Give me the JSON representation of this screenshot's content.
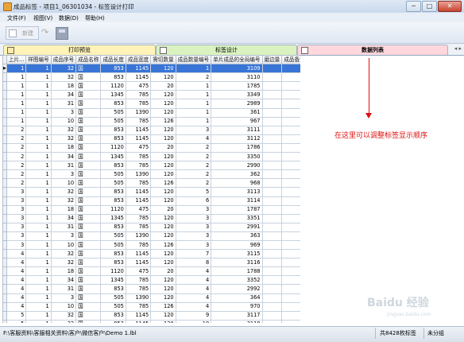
{
  "window": {
    "title": "成品标签 - 项目1_06301034 - 标签设计打印",
    "min": "─",
    "max": "□",
    "close": "✕"
  },
  "menu": [
    "文件(F)",
    "视图(V)",
    "数据(D)",
    "帮助(H)"
  ],
  "toolbar": {
    "new_label": "新建"
  },
  "tabs": [
    "打印预览",
    "标签设计",
    "数据列表"
  ],
  "tab_scroll": "◂ ▸",
  "table": {
    "headers": [
      "上片...",
      "样图编号",
      "成品序号",
      "成品名称",
      "成品长度",
      "成品宽度",
      "需切数量",
      "成品数量编号",
      "单片成品的全局编号",
      "磨边量",
      "成品备注"
    ],
    "rows": [
      [
        "1",
        "1",
        "32",
        "国",
        "853",
        "1145",
        "120",
        "1",
        "3109",
        "",
        ""
      ],
      [
        "1",
        "1",
        "32",
        "国",
        "853",
        "1145",
        "120",
        "2",
        "3110",
        "",
        ""
      ],
      [
        "1",
        "1",
        "18",
        "国",
        "1120",
        "475",
        "20",
        "1",
        "1785",
        "",
        ""
      ],
      [
        "1",
        "1",
        "34",
        "国",
        "1345",
        "785",
        "120",
        "1",
        "3349",
        "",
        ""
      ],
      [
        "1",
        "1",
        "31",
        "国",
        "853",
        "785",
        "120",
        "1",
        "2989",
        "",
        ""
      ],
      [
        "1",
        "1",
        "3",
        "国",
        "505",
        "1390",
        "120",
        "1",
        "361",
        "",
        ""
      ],
      [
        "1",
        "1",
        "10",
        "国",
        "505",
        "785",
        "126",
        "1",
        "967",
        "",
        ""
      ],
      [
        "2",
        "1",
        "32",
        "国",
        "853",
        "1145",
        "120",
        "3",
        "3111",
        "",
        ""
      ],
      [
        "2",
        "1",
        "32",
        "国",
        "853",
        "1145",
        "120",
        "4",
        "3112",
        "",
        ""
      ],
      [
        "2",
        "1",
        "18",
        "国",
        "1120",
        "475",
        "20",
        "2",
        "1786",
        "",
        ""
      ],
      [
        "2",
        "1",
        "34",
        "国",
        "1345",
        "785",
        "120",
        "2",
        "3350",
        "",
        ""
      ],
      [
        "2",
        "1",
        "31",
        "国",
        "853",
        "785",
        "120",
        "2",
        "2990",
        "",
        ""
      ],
      [
        "2",
        "1",
        "3",
        "国",
        "505",
        "1390",
        "120",
        "2",
        "362",
        "",
        ""
      ],
      [
        "2",
        "1",
        "10",
        "国",
        "505",
        "785",
        "126",
        "2",
        "968",
        "",
        ""
      ],
      [
        "3",
        "1",
        "32",
        "国",
        "853",
        "1145",
        "120",
        "5",
        "3113",
        "",
        ""
      ],
      [
        "3",
        "1",
        "32",
        "国",
        "853",
        "1145",
        "120",
        "6",
        "3114",
        "",
        ""
      ],
      [
        "3",
        "1",
        "18",
        "国",
        "1120",
        "475",
        "20",
        "3",
        "1787",
        "",
        ""
      ],
      [
        "3",
        "1",
        "34",
        "国",
        "1345",
        "785",
        "120",
        "3",
        "3351",
        "",
        ""
      ],
      [
        "3",
        "1",
        "31",
        "国",
        "853",
        "785",
        "120",
        "3",
        "2991",
        "",
        ""
      ],
      [
        "3",
        "1",
        "3",
        "国",
        "505",
        "1390",
        "120",
        "3",
        "363",
        "",
        ""
      ],
      [
        "3",
        "1",
        "10",
        "国",
        "505",
        "785",
        "126",
        "3",
        "969",
        "",
        ""
      ],
      [
        "4",
        "1",
        "32",
        "国",
        "853",
        "1145",
        "120",
        "7",
        "3115",
        "",
        ""
      ],
      [
        "4",
        "1",
        "32",
        "国",
        "853",
        "1145",
        "120",
        "8",
        "3116",
        "",
        ""
      ],
      [
        "4",
        "1",
        "18",
        "国",
        "1120",
        "475",
        "20",
        "4",
        "1788",
        "",
        ""
      ],
      [
        "4",
        "1",
        "34",
        "国",
        "1345",
        "785",
        "120",
        "4",
        "3352",
        "",
        ""
      ],
      [
        "4",
        "1",
        "31",
        "国",
        "853",
        "785",
        "120",
        "4",
        "2992",
        "",
        ""
      ],
      [
        "4",
        "1",
        "3",
        "国",
        "505",
        "1390",
        "120",
        "4",
        "364",
        "",
        ""
      ],
      [
        "4",
        "1",
        "10",
        "国",
        "505",
        "785",
        "126",
        "4",
        "970",
        "",
        ""
      ],
      [
        "5",
        "1",
        "32",
        "国",
        "853",
        "1145",
        "120",
        "9",
        "3117",
        "",
        ""
      ],
      [
        "5",
        "1",
        "32",
        "国",
        "853",
        "1145",
        "120",
        "10",
        "3118",
        "",
        ""
      ]
    ],
    "selected_row": 0,
    "row_pointer": "▶"
  },
  "annotation": {
    "text": "在这里可以调整标签显示顺序",
    "color": "#dd1111"
  },
  "watermark": {
    "text": "Baidu 经验",
    "sub": "jingyan.baidu.com"
  },
  "status": {
    "path": "F:\\客服资料\\客服相关资料\\客户\\微信客户\\Demo 1.lbl",
    "count": "共8428枚标签",
    "unsaved": "未分组"
  },
  "colors": {
    "selection": "#3875d6",
    "tab_preview": "#fff3b8",
    "tab_design": "#d9f2c0",
    "tab_data": "#ffd7dd"
  }
}
